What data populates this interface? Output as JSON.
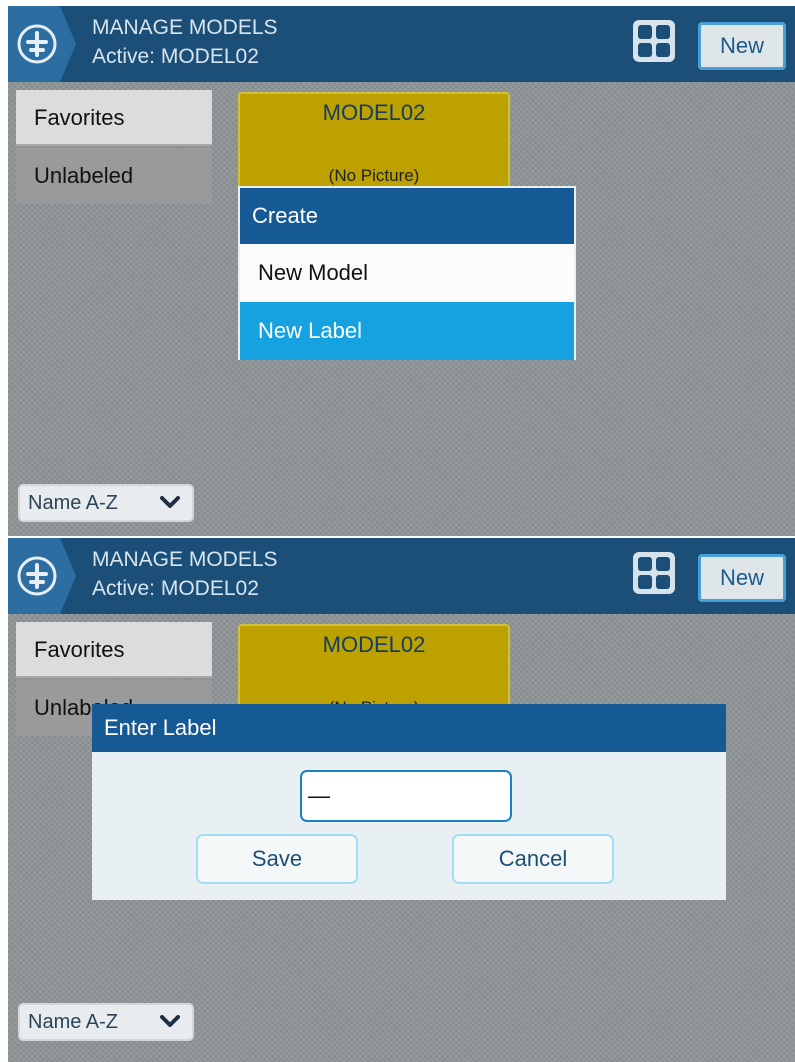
{
  "colors": {
    "header_bg": "#1b4f78",
    "accent_blue": "#155a94",
    "selected_item": "#16a1e0",
    "model_card": "#bca100",
    "screen_bg": "#8f9597"
  },
  "screen1": {
    "header": {
      "icon": "plus-circle-icon",
      "title": "MANAGE MODELS",
      "active": "Active: MODEL02",
      "grid_icon": "grid-view-icon",
      "new_button": "New"
    },
    "labels": [
      "Favorites",
      "Unlabeled"
    ],
    "model_card": {
      "name": "MODEL02",
      "picture": "(No Picture)"
    },
    "sort": {
      "value": "Name A-Z",
      "icon": "chevron-down-icon"
    },
    "create_popup": {
      "title": "Create",
      "items": [
        {
          "label": "New Model",
          "selected": false
        },
        {
          "label": "New Label",
          "selected": true
        }
      ]
    }
  },
  "screen2": {
    "header": {
      "icon": "plus-circle-icon",
      "title": "MANAGE MODELS",
      "active": "Active: MODEL02",
      "grid_icon": "grid-view-icon",
      "new_button": "New"
    },
    "labels": [
      "Favorites",
      "Unlabeled"
    ],
    "model_card": {
      "name": "MODEL02",
      "picture": "(No Picture)"
    },
    "sort": {
      "value": "Name A-Z",
      "icon": "chevron-down-icon"
    },
    "dialog": {
      "title": "Enter Label",
      "input_value": "—",
      "save_label": "Save",
      "cancel_label": "Cancel"
    }
  }
}
